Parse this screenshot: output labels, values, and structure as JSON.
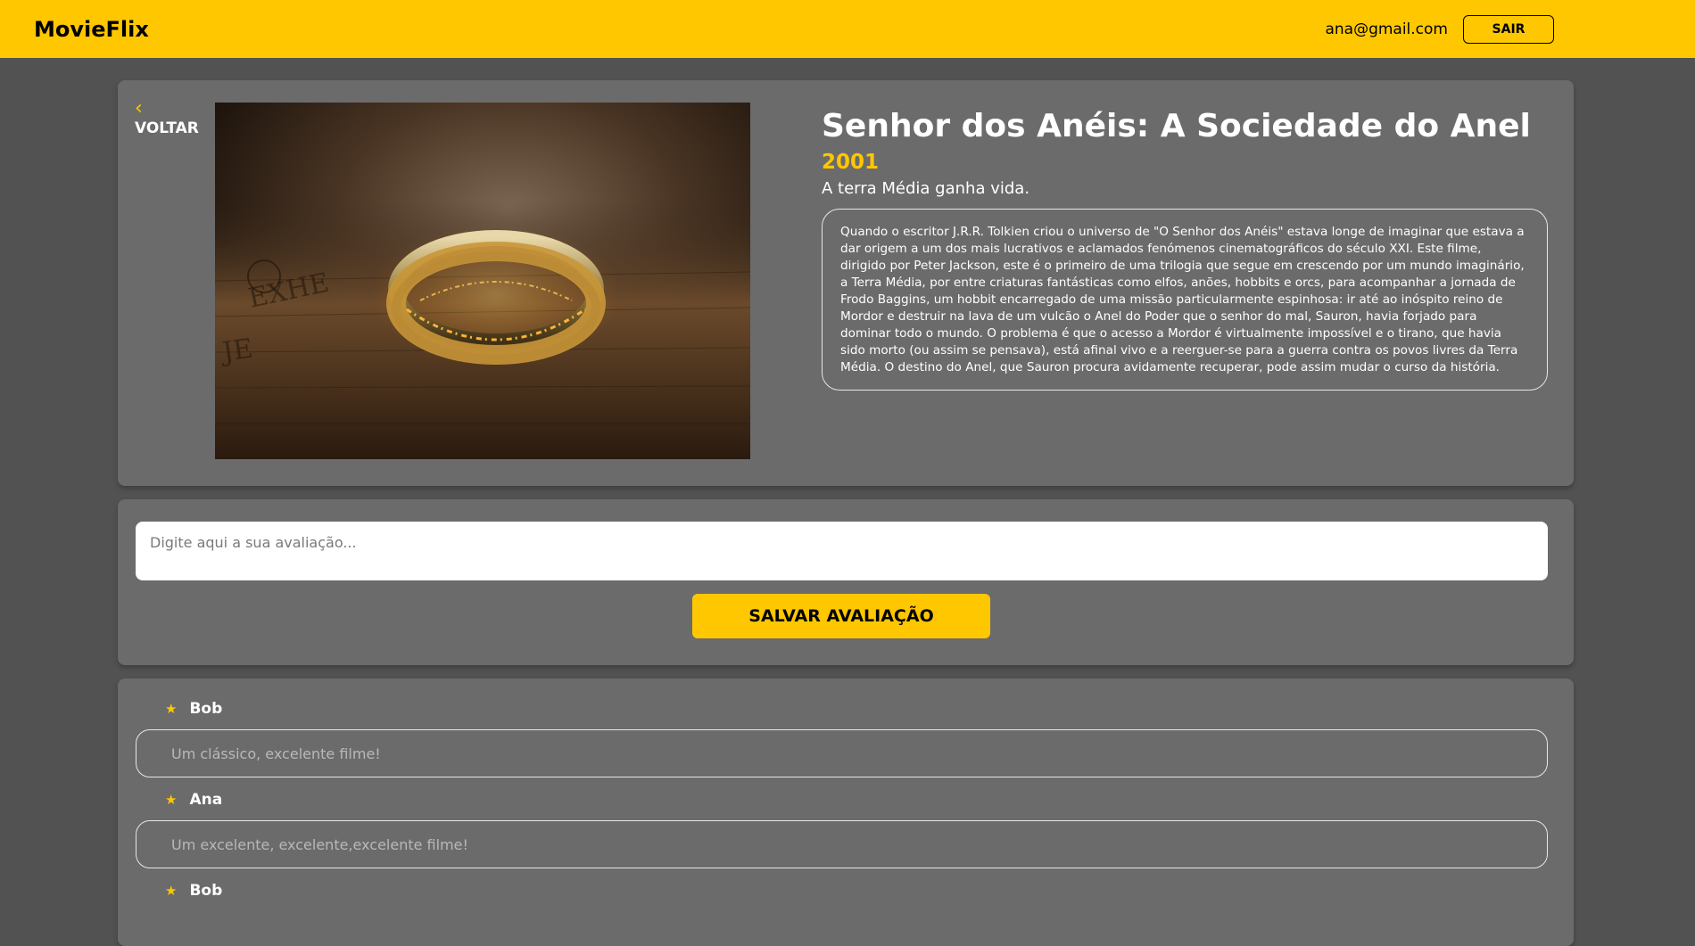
{
  "navbar": {
    "brand": "MovieFlix",
    "user_email": "ana@gmail.com",
    "logout_label": "SAIR",
    "accent_color": "#ffc700"
  },
  "details": {
    "back_label": "VOLTAR",
    "back_icon": "chevron-left-icon",
    "poster_alt": "ring-on-map-image",
    "title": "Senhor dos Anéis: A Sociedade do Anel",
    "year": "2001",
    "subtitle": "A terra Média ganha vida.",
    "synopsis": "Quando o escritor J.R.R. Tolkien criou o universo de \"O Senhor dos Anéis\" estava longe de imaginar que estava a dar origem a um dos mais lucrativos e aclamados fenómenos cinematográficos do século XXI. Este filme, dirigido por Peter Jackson, este é o primeiro de uma trilogia que segue em crescendo por um mundo imaginário, a Terra Média, por entre criaturas fantásticas como elfos, anões, hobbits e orcs, para acompanhar a jornada de Frodo Baggins, um hobbit encarregado de uma missão particularmente espinhosa: ir até ao inóspito reino de Mordor e destruir na lava de um vulcão o Anel do Poder que o senhor do mal, Sauron, havia forjado para dominar todo o mundo. O problema é que o acesso a Mordor é virtualmente impossível e o tirano, que havia sido morto (ou assim se pensava), está afinal vivo e a reerguer-se para a guerra contra os povos livres da Terra Média. O destino do Anel, que Sauron procura avidamente recuperar, pode assim mudar o curso da história."
  },
  "review_form": {
    "placeholder": "Digite aqui a sua avaliação...",
    "save_label": "SALVAR AVALIAÇÃO"
  },
  "reviews": [
    {
      "author": "Bob",
      "icon": "star-icon",
      "text": "Um clássico, excelente filme!"
    },
    {
      "author": "Ana",
      "icon": "star-icon",
      "text": "Um excelente, excelente,excelente filme!"
    },
    {
      "author": "Bob",
      "icon": "star-icon",
      "text": ""
    }
  ]
}
